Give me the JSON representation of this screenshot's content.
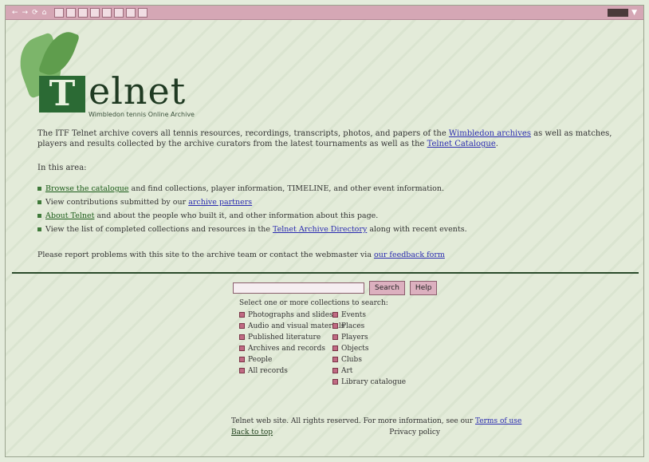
{
  "toolbar": {
    "links": [
      "←",
      "→",
      "⟳",
      "⌂"
    ],
    "icons": [
      "A",
      "B",
      "C",
      "D",
      "E",
      "F",
      "G",
      "H"
    ],
    "right_label": "▼"
  },
  "logo": {
    "mark": "T",
    "word": "elnet",
    "tagline": "Wimbledon tennis Online Archive"
  },
  "intro": {
    "text1": "The ITF Telnet archive covers all tennis resources, recordings, transcripts, photos, and papers of the ",
    "link1": "Wimbledon archives",
    "text2": " as well as matches, players and results collected by the",
    "text3": " archive curators from the latest tournaments as well as the ",
    "link2": "Telnet Catalogue",
    "text4": "."
  },
  "sections_label": "In this area:",
  "bullets": [
    {
      "link": "Browse the catalogue",
      "text": " and find collections, player information, TIMELINE, and other event information.",
      "blue": false
    },
    {
      "link": "",
      "text": "View contributions submitted by our ",
      "link2": "archive partners",
      "blue": false
    },
    {
      "link": "About Telnet",
      "text": " and about the people who built it, and other information about this page.",
      "blue": false
    },
    {
      "link": "",
      "text": "View the list of completed collections and resources in the ",
      "link2": "Telnet Archive Directory",
      "text2": " along with recent events.",
      "blue": true
    }
  ],
  "subscribe": {
    "text": "Please report problems with this site to the archive team or contact the webmaster via ",
    "link": "our feedback form"
  },
  "search": {
    "value": "",
    "placeholder": "",
    "search_button": "Search",
    "help_button": "Help",
    "label": "Select one or more collections to search:",
    "left_options": [
      "Photographs and slides",
      "Audio and visual materials",
      "Published literature",
      "Archives and records",
      "People",
      "All records"
    ],
    "right_options": [
      "Events",
      "Places",
      "Players",
      "Objects",
      "Clubs",
      "Art",
      "Library catalogue"
    ]
  },
  "footer": {
    "line1_text": "Telnet web site. All rights reserved. For more information, see our ",
    "line1_link": "Terms of use",
    "left_link": "Back to top",
    "right_text": "Privacy policy"
  }
}
